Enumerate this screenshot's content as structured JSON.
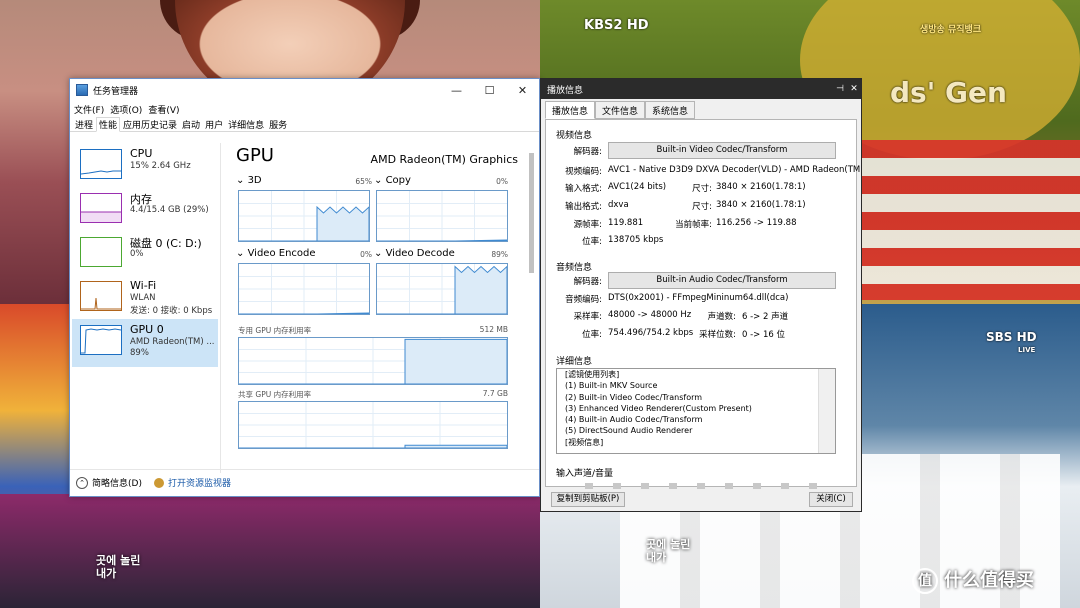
{
  "backdrop": {
    "top_right_logo": "KBS2 HD",
    "top_right_tag": "생방송 뮤직뱅크",
    "top_right_banner": "ds' Gen",
    "bottom_right_logo": "SBS HD",
    "bottom_right_live": "LIVE",
    "subtitle_left": "곳에 놀린\n내가",
    "subtitle_right": "곳에 놀린\n내가",
    "watermark": "什么值得买"
  },
  "task_manager": {
    "title": "任务管理器",
    "menu": [
      "文件(F)",
      "选项(O)",
      "查看(V)"
    ],
    "tabs": [
      "进程",
      "性能",
      "应用历史记录",
      "启动",
      "用户",
      "详细信息",
      "服务"
    ],
    "active_tab": 1,
    "resources": [
      {
        "name": "CPU",
        "line1": "15% 2.64 GHz",
        "line2": "",
        "color": "#1c6fc2"
      },
      {
        "name": "内存",
        "line1": "4.4/15.4 GB (29%)",
        "line2": "",
        "color": "#9a2fb0"
      },
      {
        "name": "磁盘 0 (C: D:)",
        "line1": "0%",
        "line2": "",
        "color": "#4ca832"
      },
      {
        "name": "Wi-Fi",
        "line1": "WLAN",
        "line2": "发送: 0 接收: 0 Kbps",
        "color": "#b0641c"
      },
      {
        "name": "GPU 0",
        "line1": "AMD Radeon(TM) ...",
        "line2": "89%",
        "color": "#1c6fc2"
      }
    ],
    "selected_resource": 4,
    "gpu": {
      "title": "GPU",
      "model": "AMD Radeon(TM) Graphics",
      "engines": [
        {
          "label": "3D",
          "percent": "65%",
          "level": 0.62
        },
        {
          "label": "Copy",
          "percent": "0%",
          "level": 0.0
        },
        {
          "label": "Video Encode",
          "percent": "0%",
          "level": 0.0
        },
        {
          "label": "Video Decode",
          "percent": "89%",
          "level": 0.89
        }
      ],
      "dedicated_label": "专用 GPU 内存利用率",
      "dedicated_max": "512 MB",
      "dedicated_level": 0.97,
      "shared_label": "共享 GPU 内存利用率",
      "shared_max": "7.7 GB",
      "shared_level": 0.06
    },
    "footer_summary": "简略信息(D)",
    "footer_monitor": "打开资源监视器"
  },
  "playback_info": {
    "title": "播放信息",
    "pin_glyph": "⊣",
    "close_glyph": "✕",
    "tabs": [
      "播放信息",
      "文件信息",
      "系统信息"
    ],
    "active_tab": 0,
    "video_section": "视频信息",
    "decoder_label": "解码器:",
    "video_decoder": "Built-in Video Codec/Transform",
    "video_codec_label": "视频编码:",
    "video_codec": "AVC1 - Native D3D9 DXVA Decoder(VLD) - AMD Radeon(TM",
    "input_format_label": "输入格式:",
    "input_format": "AVC1(24 bits)",
    "size_label": "尺寸:",
    "input_size": "3840 × 2160(1.78:1)",
    "output_format_label": "输出格式:",
    "output_format": "dxva",
    "output_size": "3840 × 2160(1.78:1)",
    "src_fps_label": "源帧率:",
    "src_fps": "119.881",
    "cur_fps_label": "当前帧率:",
    "cur_fps": "116.256 -> 119.88",
    "bitrate_label": "位率:",
    "video_bitrate": "138705 kbps",
    "audio_section": "音频信息",
    "audio_decoder": "Built-in Audio Codec/Transform",
    "audio_codec_label": "音频编码:",
    "audio_codec": "DTS(0x2001) - FFmpegMininum64.dll(dca)",
    "sample_rate_label": "采样率:",
    "sample_rate": "48000 -> 48000 Hz",
    "channels_label": "声道数:",
    "channels": "6 -> 2 声道",
    "audio_bitrate": "754.496/754.2 kbps",
    "sample_bits_label": "采样位数:",
    "sample_bits": "0 -> 16 位",
    "detail_section": "详细信息",
    "detail_lines": [
      "[滤镜使用列表]",
      "(1) Built-in MKV Source",
      "(2) Built-in Video Codec/Transform",
      "(3) Enhanced Video Renderer(Custom Present)",
      "(4) Built-in Audio Codec/Transform",
      "(5) DirectSound Audio Renderer",
      "[视频信息]"
    ],
    "channel_section": "输入声道/音量",
    "copy_button": "复制到剪贴板(P)",
    "close_button": "关闭(C)"
  }
}
